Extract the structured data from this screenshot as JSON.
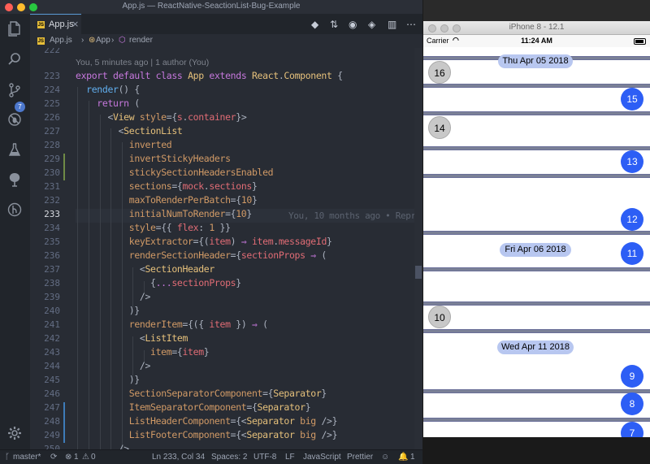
{
  "vscode": {
    "title": "App.js — ReactNative-SeactionList-Bug-Example",
    "tab": {
      "label": "App.js",
      "close": "×",
      "icon": "js-file-icon"
    },
    "breadcrumb": {
      "file": "App.js",
      "sep1": "›",
      "class": "App",
      "sep2": "›",
      "method": "render"
    },
    "activity_bar": {
      "icons": [
        "files-icon",
        "search-icon",
        "source-control-icon",
        "debug-icon",
        "test-icon",
        "tree-icon",
        "git-graph-icon",
        "settings-icon"
      ],
      "source_control_badge": "7"
    },
    "codelens": "You, 5 minutes ago | 1 author (You)",
    "blame": "You, 10 months ago • Repr",
    "line_numbers": [
      "222",
      "223",
      "224",
      "225",
      "226",
      "227",
      "228",
      "229",
      "230",
      "231",
      "232",
      "233",
      "234",
      "235",
      "236",
      "237",
      "238",
      "239",
      "240",
      "241",
      "242",
      "243",
      "244",
      "245",
      "246",
      "247",
      "248",
      "249",
      "250"
    ],
    "current_line": "233",
    "status": {
      "branch": "master*",
      "errors": "1",
      "warnings": "0",
      "position": "Ln 233, Col 34",
      "spaces": "Spaces: 2",
      "encoding": "UTF-8",
      "eol": "LF",
      "language": "JavaScript",
      "formatter": "Prettier",
      "notifications": "1"
    }
  },
  "simulator": {
    "title": "iPhone 8 - 12.1",
    "carrier": "Carrier",
    "time": "11:24 AM",
    "headers": [
      "Thu Apr 05 2018",
      "Fri Apr 06 2018",
      "Wed Apr 11 2018"
    ],
    "bubbles": [
      "16",
      "15",
      "14",
      "13",
      "12",
      "11",
      "10",
      "9",
      "8",
      "7"
    ],
    "separator_color": "#7a8096",
    "header_color": "#b8c7f0",
    "right_bubble_color": "#2d5ef5",
    "left_bubble_color": "#c8c8c8"
  }
}
